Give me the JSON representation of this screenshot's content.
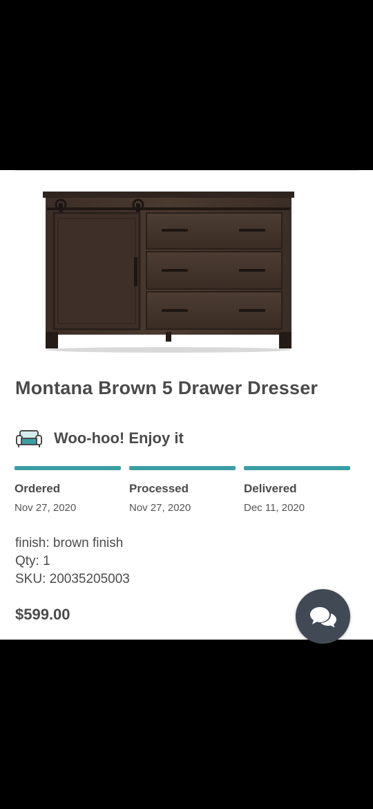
{
  "product": {
    "title": "Montana Brown 5 Drawer Dresser",
    "image_icon": "dresser-image"
  },
  "status": {
    "icon": "sofa-icon",
    "message": "Woo-hoo! Enjoy it"
  },
  "progress": {
    "bar_color": "#3a9fa4",
    "steps": [
      {
        "label": "Ordered",
        "date": "Nov 27, 2020",
        "complete": true
      },
      {
        "label": "Processed",
        "date": "Nov 27, 2020",
        "complete": true
      },
      {
        "label": "Delivered",
        "date": "Dec 11, 2020",
        "complete": true
      }
    ]
  },
  "details": {
    "finish": "finish: brown finish",
    "qty": "Qty: 1",
    "sku": "SKU: 20035205003"
  },
  "price": "$599.00",
  "chat": {
    "icon": "chat-bubbles-icon"
  }
}
